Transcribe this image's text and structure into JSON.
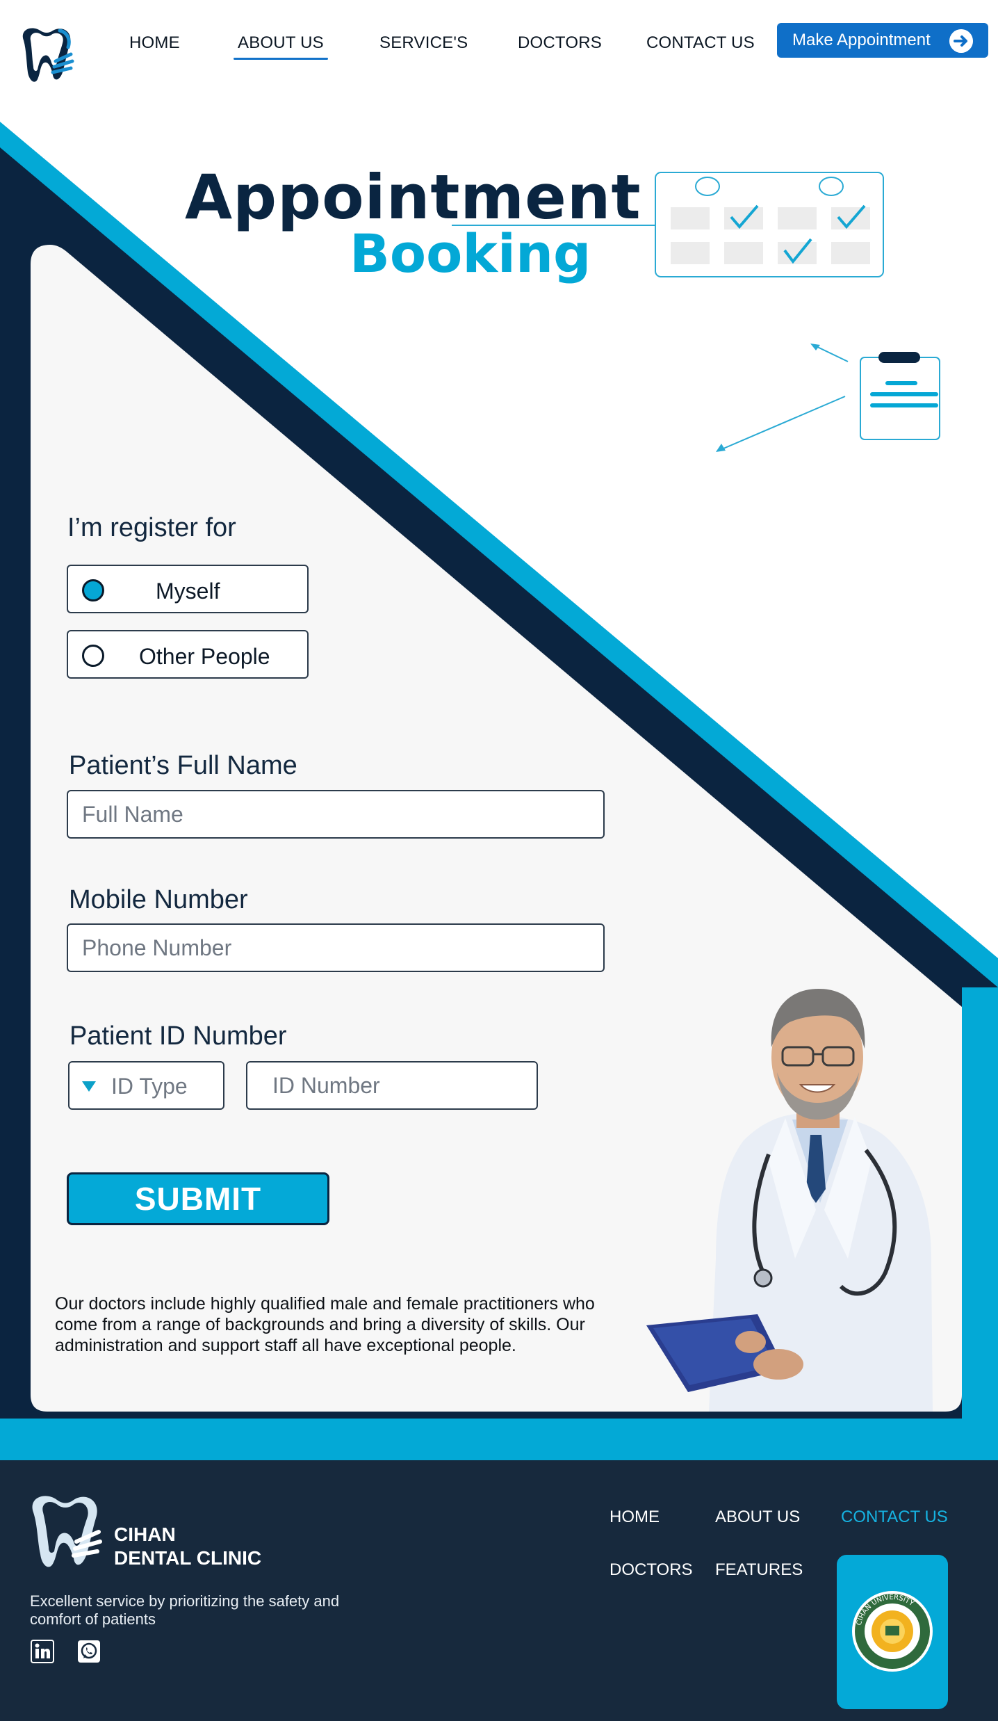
{
  "nav": {
    "items": [
      "HOME",
      "ABOUT US",
      "SERVICE'S",
      "DOCTORS",
      "CONTACT US"
    ],
    "active": "ABOUT US",
    "cta_label": "Make Appointment"
  },
  "hero": {
    "title_line1": "Appointment",
    "title_line2": "Booking"
  },
  "form": {
    "register_label": "I’m register for",
    "options": [
      {
        "label": "Myself",
        "selected": true
      },
      {
        "label": "Other People",
        "selected": false
      }
    ],
    "full_name_label": "Patient’s Full Name",
    "full_name_placeholder": "Full Name",
    "mobile_label": "Mobile Number",
    "mobile_placeholder": "Phone Number",
    "id_label": "Patient ID Number",
    "id_type_placeholder": "ID Type",
    "id_number_placeholder": "ID Number",
    "submit_label": "SUBMIT"
  },
  "description": "Our doctors include highly qualified male and female practitioners who come from a range of backgrounds and bring a diversity of skills. Our administration and support staff all have exceptional people.",
  "footer": {
    "brand_line1": "CIHAN",
    "brand_line2": "DENTAL CLINIC",
    "tagline": "Excellent service by prioritizing the safety and comfort of patients",
    "links": [
      "HOME",
      "ABOUT US",
      "CONTACT US",
      "DOCTORS",
      "FEATURES"
    ],
    "social": [
      "linkedin-icon",
      "whatsapp-icon"
    ],
    "seal_text": "CIHAN UNIVERSITY"
  },
  "colors": {
    "navy": "#0a2541",
    "cyan": "#04a9d7",
    "nav_blue": "#0f6fc8",
    "footer_bg": "#17293d",
    "card_bg": "#f7f7f7"
  }
}
